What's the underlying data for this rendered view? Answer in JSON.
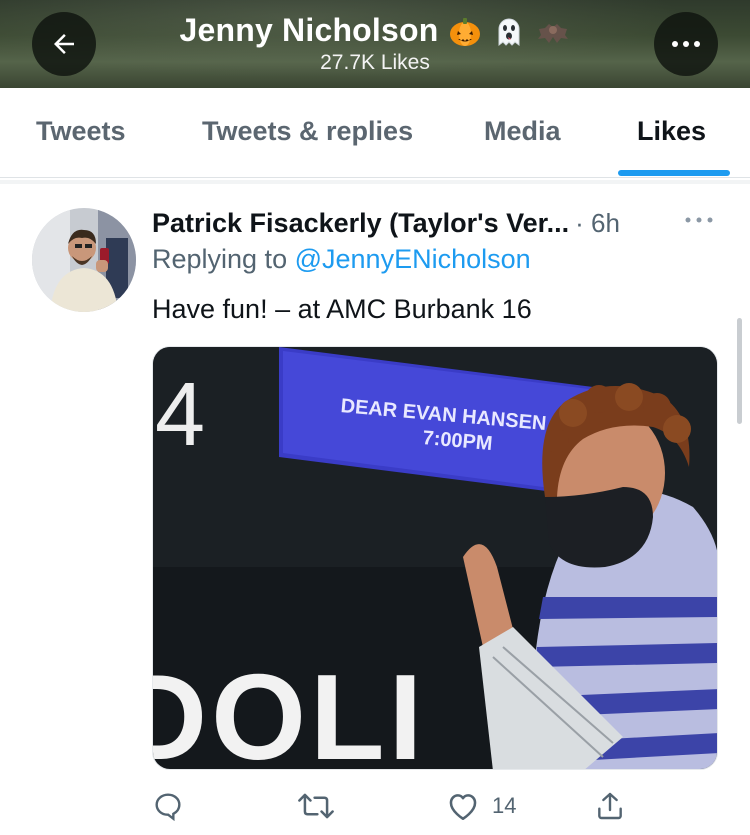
{
  "header": {
    "name": "Jenny Nicholson",
    "likes": "27.7K Likes",
    "name_emojis": [
      "pumpkin-emoji",
      "ghost-emoji",
      "bat-emoji"
    ]
  },
  "tabs": [
    {
      "label": "Tweets",
      "active": false
    },
    {
      "label": "Tweets & replies",
      "active": false
    },
    {
      "label": "Media",
      "active": false
    },
    {
      "label": "Likes",
      "active": true
    }
  ],
  "tweet": {
    "author": "Patrick Fisackerly (Taylor's Ver...",
    "time": "· 6h",
    "replying_prefix": "Replying to",
    "replying_handle": "@JennyENicholson",
    "text": "Have fun! – at AMC Burbank 16",
    "media": {
      "sign_line1": "DEAR EVAN HANSEN",
      "sign_line2": "7:00PM",
      "wall_number": "4",
      "wall_text": "DOLI"
    },
    "actions": {
      "reply_icon": "reply-icon",
      "retweet_icon": "retweet-icon",
      "like_icon": "heart-icon",
      "like_count": "14",
      "share_icon": "share-icon"
    }
  },
  "colors": {
    "accent": "#1d9bf0",
    "text_primary": "#0f1419",
    "text_secondary": "#536471"
  }
}
